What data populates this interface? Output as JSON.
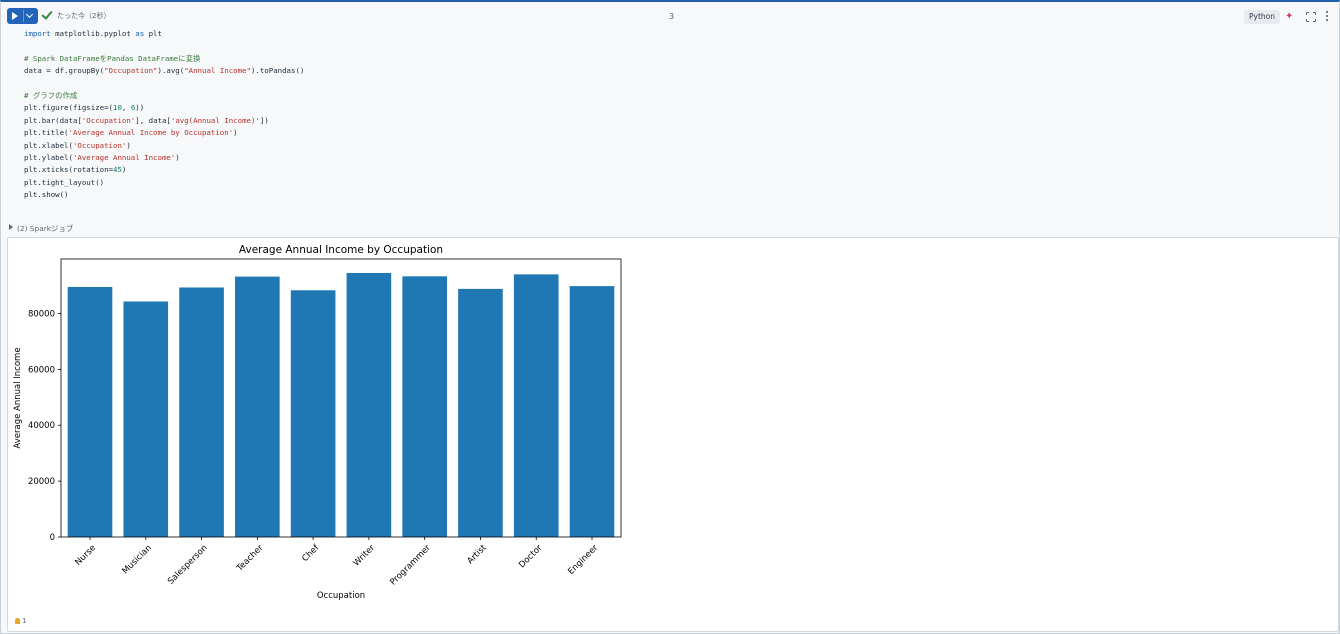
{
  "toolbar": {
    "run_label": "Run",
    "status_text": "たった今（2秒）",
    "cell_number": "3",
    "language": "Python"
  },
  "code_lines": [
    "import matplotlib.pyplot as plt",
    "",
    "# Spark DataFrameをPandas DataFrameに変換",
    "data = df.groupBy(\"Occupation\").avg(\"Annual Income\").toPandas()",
    "",
    "# グラフの作成",
    "plt.figure(figsize=(10, 6))",
    "plt.bar(data['Occupation'], data['avg(Annual Income)'])",
    "plt.title('Average Annual Income by Occupation')",
    "plt.xlabel('Occupation')",
    "plt.ylabel('Average Annual Income')",
    "plt.xticks(rotation=45)",
    "plt.tight_layout()",
    "plt.show()"
  ],
  "spark_jobs_label": "(2) Sparkジョブ",
  "footer_count": "1",
  "chart_data": {
    "type": "bar",
    "title": "Average Annual Income by Occupation",
    "xlabel": "Occupation",
    "ylabel": "Average Annual Income",
    "categories": [
      "Nurse",
      "Musician",
      "Salesperson",
      "Teacher",
      "Chef",
      "Writer",
      "Programmer",
      "Artist",
      "Doctor",
      "Engineer"
    ],
    "values": [
      89500,
      84300,
      89300,
      93200,
      88300,
      94500,
      93300,
      88800,
      94000,
      89800
    ],
    "ylim": [
      0,
      99500
    ],
    "yticks": [
      0,
      20000,
      40000,
      60000,
      80000
    ],
    "bar_color": "#1f77b4",
    "xtick_rotation": 45
  }
}
